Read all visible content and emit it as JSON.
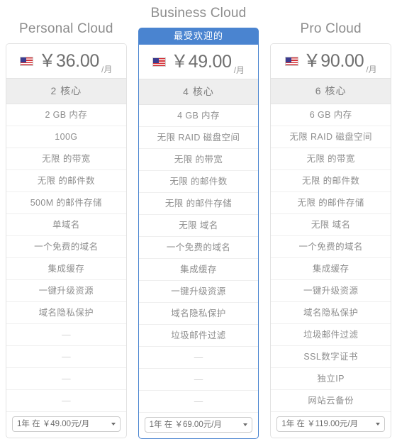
{
  "plans": [
    {
      "title": "Personal Cloud",
      "featured": false,
      "ribbon": "",
      "flag": "us-flag-icon",
      "price": "￥36.00",
      "period": "/月",
      "cores": "2 核心",
      "features": [
        "2 GB 内存",
        "100G",
        "无限 的带宽",
        "无限 的邮件数",
        "500M 的邮件存储",
        "单域名",
        "一个免费的域名",
        "集成缓存",
        "一键升级资源",
        "域名隐私保护",
        "—",
        "—",
        "—",
        "—"
      ],
      "term_option": "1年 在 ￥49.00元/月"
    },
    {
      "title": "Business Cloud",
      "featured": true,
      "ribbon": "最受欢迎的",
      "flag": "us-flag-icon",
      "price": "￥49.00",
      "period": "/月",
      "cores": "4 核心",
      "features": [
        "4 GB 内存",
        "无限 RAID 磁盘空间",
        "无限 的带宽",
        "无限 的邮件数",
        "无限 的邮件存储",
        "无限 域名",
        "一个免费的域名",
        "集成缓存",
        "一键升级资源",
        "域名隐私保护",
        "垃圾邮件过滤",
        "—",
        "—",
        "—"
      ],
      "term_option": "1年 在 ￥69.00元/月"
    },
    {
      "title": "Pro Cloud",
      "featured": false,
      "ribbon": "",
      "flag": "us-flag-icon",
      "price": "￥90.00",
      "period": "/月",
      "cores": "6 核心",
      "features": [
        "6 GB 内存",
        "无限 RAID 磁盘空间",
        "无限 的带宽",
        "无限 的邮件数",
        "无限 的邮件存储",
        "无限 域名",
        "一个免费的域名",
        "集成缓存",
        "一键升级资源",
        "域名隐私保护",
        "垃圾邮件过滤",
        "SSL数字证书",
        "独立IP",
        "网站云备份"
      ],
      "term_option": "1年 在 ￥119.00元/月"
    }
  ],
  "colors": {
    "accent": "#4a84d0",
    "cores_band": "#eeeeee",
    "text": "#8e8e8e",
    "border": "#e2e2e2"
  }
}
